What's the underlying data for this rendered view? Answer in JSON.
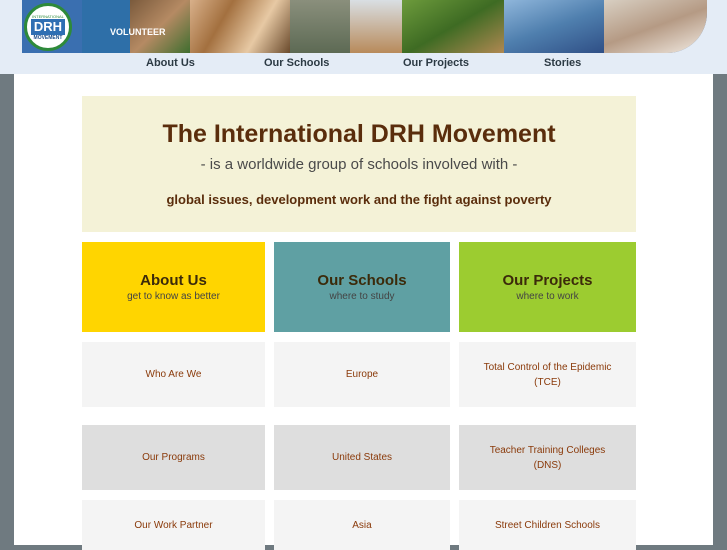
{
  "header": {
    "logo": {
      "top": "INTERNATIONAL",
      "main": "DRH",
      "sub": "MOVEMENT"
    },
    "banner_label": "VOLUNTEER"
  },
  "nav": [
    {
      "label": "About Us"
    },
    {
      "label": "Our Schools"
    },
    {
      "label": "Our Projects"
    },
    {
      "label": "Stories"
    }
  ],
  "hero": {
    "title": "The International DRH Movement",
    "subtitle": "- is a worldwide group of schools involved with -",
    "tagline": "global issues, development work and the fight against poverty"
  },
  "categories": [
    {
      "title": "About Us",
      "subtitle": "get to know as better",
      "color": "#ffd500"
    },
    {
      "title": "Our Schools",
      "subtitle": "where to study",
      "color": "#5fa0a3"
    },
    {
      "title": "Our Projects",
      "subtitle": "where to work",
      "color": "#9ccc30"
    }
  ],
  "rows": [
    [
      "Who Are We",
      "Europe",
      "Total Control of the Epidemic (TCE)"
    ],
    [
      "Our Programs",
      "United States",
      "Teacher Training Colleges (DNS)"
    ],
    [
      "Our Work Partner",
      "Asia",
      "Street Children Schools"
    ]
  ]
}
